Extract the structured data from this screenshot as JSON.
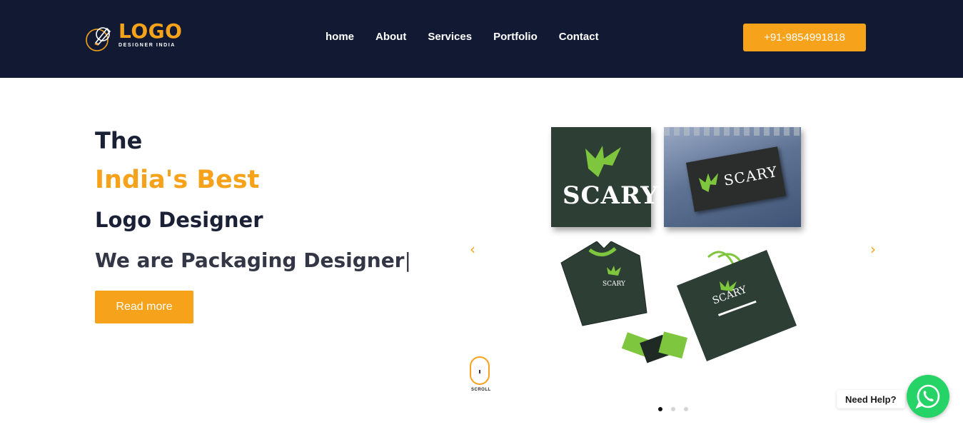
{
  "header": {
    "logo": {
      "word": "LOGO",
      "tagline": "DESIGNER INDIA"
    },
    "nav": [
      {
        "label": "home"
      },
      {
        "label": "About"
      },
      {
        "label": "Services"
      },
      {
        "label": "Portfolio"
      },
      {
        "label": "Contact"
      }
    ],
    "phone": "+91-9854991818"
  },
  "hero": {
    "line1": "The",
    "line2": "India's Best",
    "line3": "Logo Designer",
    "typed_prefix": "We are",
    "typed_word": "Packaging Designer",
    "cursor": "|",
    "cta_label": "Read more"
  },
  "slider": {
    "brand": "SCARY",
    "prev_icon": "chevron-left-icon",
    "next_icon": "chevron-right-icon",
    "dots": 3,
    "active_dot": 0
  },
  "scroll": {
    "label": "SCROLL"
  },
  "chat": {
    "label": "Need Help?",
    "icon": "whatsapp-icon"
  },
  "colors": {
    "header_bg": "#121a33",
    "accent": "#f7a21b",
    "heading": "#1a2035",
    "whatsapp": "#25d366",
    "brand_green": "#2d3e35",
    "brand_lime": "#7ec63d"
  }
}
